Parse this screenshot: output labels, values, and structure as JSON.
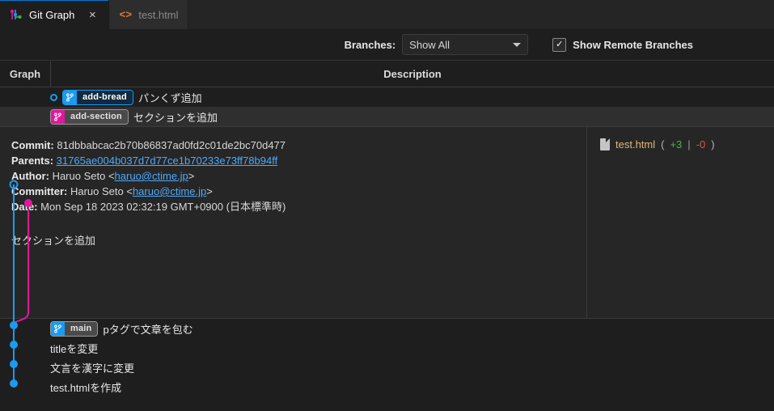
{
  "tabs": [
    {
      "label": "Git Graph",
      "icon": "git-graph-icon",
      "active": true,
      "close": "×"
    },
    {
      "label": "test.html",
      "icon": "html-file-icon",
      "active": false
    }
  ],
  "toolbar": {
    "branches_label": "Branches:",
    "branches_value": "Show All",
    "show_remote_label": "Show Remote Branches",
    "show_remote_checked": true,
    "checkmark": "✓"
  },
  "columns": {
    "graph": "Graph",
    "description": "Description"
  },
  "commits": [
    {
      "message": "パンくず追加",
      "ref": "add-bread",
      "ref_style": "blue",
      "selected": false
    },
    {
      "message": "セクションを追加",
      "ref": "add-section",
      "ref_style": "magenta",
      "selected": true
    },
    {
      "message": "pタグで文章を包む",
      "ref": "main",
      "ref_style": "main",
      "selected": false
    },
    {
      "message": "titleを変更",
      "ref": null,
      "selected": false
    },
    {
      "message": "文言を漢字に変更",
      "ref": null,
      "selected": false
    },
    {
      "message": "test.htmlを作成",
      "ref": null,
      "selected": false
    }
  ],
  "detail": {
    "commit_key": "Commit:",
    "commit_value": "81dbbabcac2b70b86837ad0fd2c01de2bc70d477",
    "parents_key": "Parents:",
    "parents_value": "31765ae004b037d7d77ce1b70233e73ff78b94ff",
    "author_key": "Author:",
    "author_name": "Haruo Seto",
    "author_email": "haruo@ctime.jp",
    "committer_key": "Committer:",
    "committer_name": "Haruo Seto",
    "committer_email": "haruo@ctime.jp",
    "date_key": "Date:",
    "date_value": "Mon Sep 18 2023 02:32:19 GMT+0900 (日本標準時)",
    "body": "セクションを追加",
    "lt": "<",
    "gt": ">",
    "files": [
      {
        "name": "test.html",
        "open_paren": "(",
        "added": "+3",
        "divider": "|",
        "removed": "-0",
        "close_paren": ")"
      }
    ]
  },
  "colors": {
    "blue": "#1a9bf0",
    "magenta": "#e0189b",
    "link": "#4daafc",
    "added": "#4caf50",
    "removed": "#e05252",
    "file_name": "#e0b778",
    "background": "#1e1e1e",
    "panel": "#262626",
    "selected_row": "#2f2f2f"
  }
}
